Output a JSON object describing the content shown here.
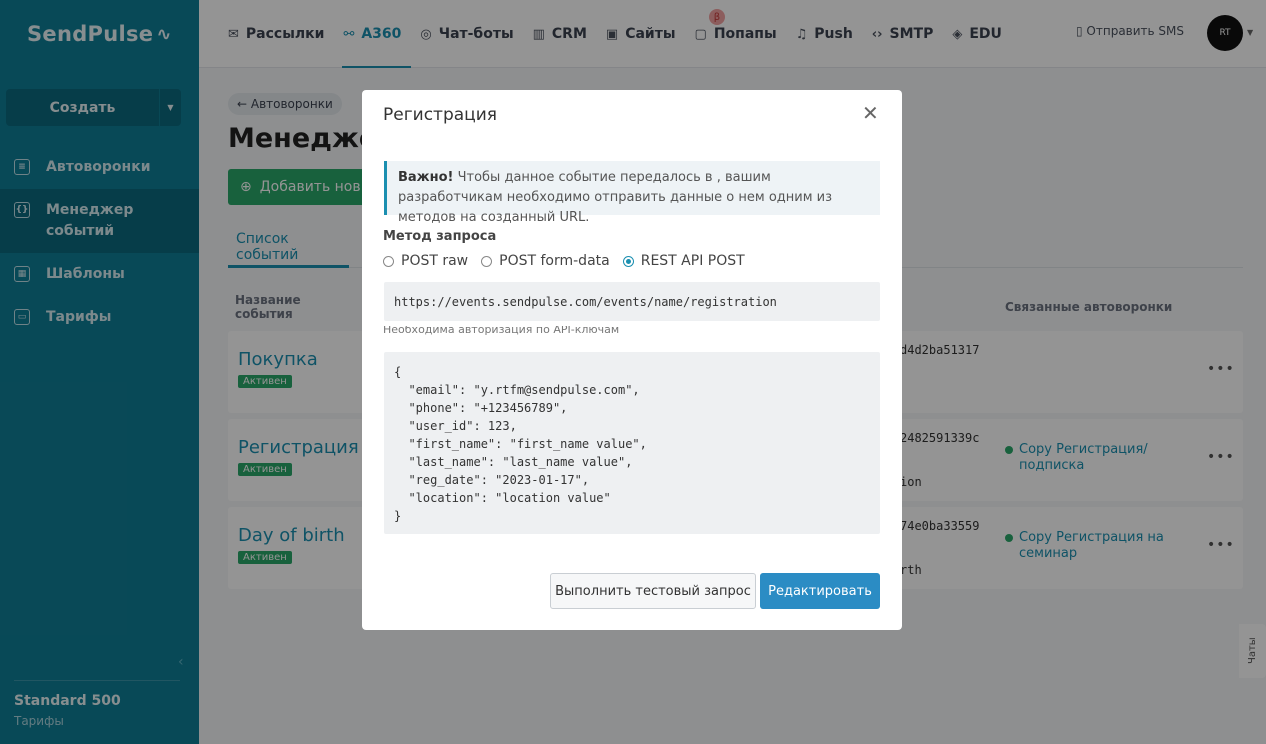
{
  "brand": {
    "logo": "SendPulse",
    "pulse": "~"
  },
  "sidebar": {
    "create_label": "Создать",
    "items": [
      {
        "label": "Автоворонки"
      },
      {
        "label": "Менеджер событий"
      },
      {
        "label": "Шаблоны"
      },
      {
        "label": "Тарифы"
      }
    ],
    "plan_name": "Standard 500",
    "plan_link": "Тарифы"
  },
  "topnav": {
    "items": [
      {
        "label": "Рассылки"
      },
      {
        "label": "A360"
      },
      {
        "label": "Чат-боты"
      },
      {
        "label": "CRM"
      },
      {
        "label": "Сайты"
      },
      {
        "label": "Попапы"
      },
      {
        "label": "Push"
      },
      {
        "label": "SMTP"
      },
      {
        "label": "EDU"
      }
    ],
    "beta": "β",
    "sms": "Отправить SMS",
    "avatar": "RT"
  },
  "page": {
    "back": "← Автоворонки",
    "title": "Менеджер",
    "add_button": "Добавить нов",
    "tab": "Список событий",
    "col_name": "Название события",
    "col_funnels": "Связанные автоворонки",
    "events": [
      {
        "name": "Покупка",
        "status": "Активен",
        "hash": "d4d2ba51317",
        "hash2": "",
        "link": ""
      },
      {
        "name": "Регистрация",
        "status": "Активен",
        "hash": "2482591339c",
        "hash2": "ion",
        "link": "Copy Регистрация/ подписка"
      },
      {
        "name": "Day of birth",
        "status": "Активен",
        "hash": "74e0ba33559",
        "hash2": "rth",
        "link": "Copy Регистрация на семинар"
      }
    ],
    "chats": "Чаты"
  },
  "modal": {
    "title": "Регистрация",
    "notice_bold": "Важно!",
    "notice_text": " Чтобы данное событие передалось в , вашим разработчикам необходимо отправить данные о нем одним из методов на созданный URL.",
    "method_label": "Метод запроса",
    "methods": [
      {
        "label": "POST raw",
        "checked": false
      },
      {
        "label": "POST form-data",
        "checked": false
      },
      {
        "label": "REST API POST",
        "checked": true
      }
    ],
    "url": "https://events.sendpulse.com/events/name/registration",
    "auth_note": "Необходима авторизация по API-ключам",
    "code": "{\n  \"email\": \"y.rtfm@sendpulse.com\",\n  \"phone\": \"+123456789\",\n  \"user_id\": 123,\n  \"first_name\": \"first_name value\",\n  \"last_name\": \"last_name value\",\n  \"reg_date\": \"2023-01-17\",\n  \"location\": \"location value\"\n}",
    "btn_test": "Выполнить тестовый запрос",
    "btn_edit": "Редактировать"
  },
  "colors": {
    "sidebar": "#0f7e96",
    "accent": "#1b8fb0",
    "success": "#2aa869",
    "primary_button": "#2b8cc4"
  }
}
